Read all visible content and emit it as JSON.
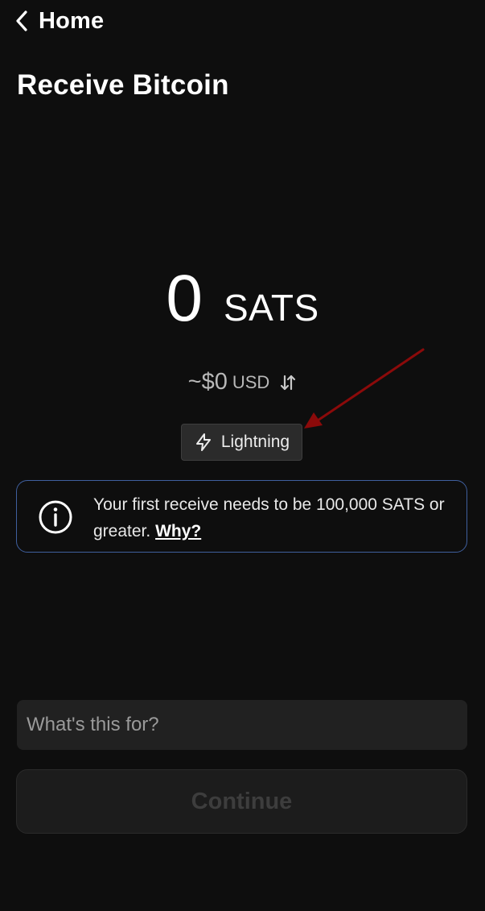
{
  "header": {
    "back_label": "Home",
    "title": "Receive Bitcoin"
  },
  "amount": {
    "value": "0",
    "unit": "SATS",
    "fiat_amount": "~$0",
    "fiat_currency": "USD"
  },
  "network": {
    "label": "Lightning"
  },
  "notice": {
    "text": "Your first receive needs to be 100,000 SATS or greater.",
    "link_label": "Why?"
  },
  "memo": {
    "placeholder": "What's this for?",
    "value": ""
  },
  "actions": {
    "continue_label": "Continue",
    "continue_enabled": false
  },
  "colors": {
    "background": "#0e0e0e",
    "info_border": "#3f5f9e",
    "annotation_arrow": "#8b0a0a"
  },
  "icons": [
    "chevron-left-icon",
    "swap-arrows-icon",
    "lightning-bolt-icon",
    "info-circle-icon"
  ]
}
